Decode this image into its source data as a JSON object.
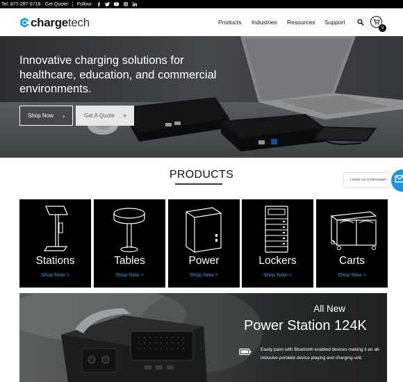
{
  "topbar": {
    "contact": "Tel: 877-287-9718 - Get Quote!",
    "follow_label": "Follow:",
    "social_icons": [
      "facebook-icon",
      "twitter-icon",
      "youtube-icon",
      "instagram-icon",
      "linkedin-icon"
    ]
  },
  "header": {
    "logo_bold": "charge",
    "logo_light": "tech",
    "nav": [
      "Products",
      "Industries",
      "Resources",
      "Support"
    ],
    "cart_count": "0",
    "brand_color": "#1e96dc"
  },
  "hero": {
    "title": "Innovative charging solutions for healthcare, education, and commercial environments.",
    "shop_label": "Shop Now",
    "quote_label": "Get A Quote"
  },
  "products": {
    "title": "PRODUCTS",
    "items": [
      {
        "name": "Stations",
        "link": "Shop Now >"
      },
      {
        "name": "Tables",
        "link": "Shop Now >"
      },
      {
        "name": "Power",
        "link": "Shop Now >"
      },
      {
        "name": "Lockers",
        "link": "Shop Now >"
      },
      {
        "name": "Carts",
        "link": "Shop Now >"
      }
    ]
  },
  "chat": {
    "label": "Leave us a message!"
  },
  "promo": {
    "eyebrow": "All New",
    "title": "Power Station 124K",
    "description": "Easily pairs with Bluetooth enabled devices making it an all-inclusive portable device playing and charging unit."
  }
}
